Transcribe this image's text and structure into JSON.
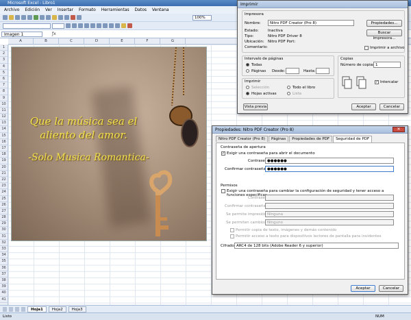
{
  "excel": {
    "title": "Microsoft Excel - Libro1",
    "menu": [
      "Archivo",
      "Edición",
      "Ver",
      "Insertar",
      "Formato",
      "Herramientas",
      "Datos",
      "Ventana"
    ],
    "name_box": "Imagen 1",
    "zoom": "100%",
    "columns": [
      "A",
      "B",
      "C",
      "D",
      "E",
      "F",
      "G"
    ],
    "picture_text_1": "Que la música sea el aliento del amor.",
    "picture_text_2": "-Solo Musica Romantica-",
    "sheets": [
      "Hoja1",
      "Hoja2",
      "Hoja3"
    ],
    "status": "Listo",
    "status_num": "NUM"
  },
  "print_dialog": {
    "title": "Imprimir",
    "printer_group": "Impresora",
    "name_label": "Nombre:",
    "name_value": "Nitro PDF Creator (Pro 8)",
    "status_label": "Estado:",
    "status_value": "Inactiva",
    "type_label": "Tipo:",
    "type_value": "Nitro PDF Driver 8",
    "location_label": "Ubicación:",
    "location_value": "Nitro PDF Port:",
    "comment_label": "Comentario:",
    "properties_btn": "Propiedades...",
    "find_printer_btn": "Buscar impresora...",
    "print_to_file": "Imprimir a archivo",
    "range_group": "Intervalo de páginas",
    "all": "Todas",
    "pages": "Páginas",
    "from": "Desde:",
    "to": "Hasta:",
    "copies_group": "Copias",
    "copies_label": "Número de copias:",
    "copies_value": "1",
    "print_group": "Imprimir",
    "selection": "Selección",
    "whole_book": "Todo el libro",
    "active_sheets": "Hojas activas",
    "list": "Lista",
    "collate": "Intercalar",
    "preview_btn": "Vista previa",
    "ok_btn": "Aceptar",
    "cancel_btn": "Cancelar"
  },
  "props_dialog": {
    "title": "Propiedades: Nitro PDF Creator (Pro 8)",
    "tabs": [
      "Nitro PDF Creator (Pro 8)",
      "Páginas",
      "Propiedades de PDF",
      "Seguridad de PDF"
    ],
    "open_group": "Contraseña de apertura",
    "require_open": "Exigir una contraseña para abrir el documento",
    "password_label": "Contraseña:",
    "password_value": "●●●●●●",
    "confirm_label": "Confirmar contraseña:",
    "confirm_value": "●●●●●●",
    "perms_group": "Permisos",
    "require_perms": "Exigir una contraseña para cambiar la configuración de seguridad y tener acceso a funciones específicas",
    "perm_password_label": "Contraseña:",
    "perm_confirm_label": "Confirmar contraseña:",
    "print_allowed_label": "Se permite impresión:",
    "print_allowed_value": "Ninguna",
    "changes_allowed_label": "Se permiten cambios:",
    "changes_allowed_value": "Ninguno",
    "copy_text": "Permitir copia de texto, imágenes y demás contenido",
    "screen_reader": "Permitir acceso a texto para dispositivos lectores de pantalla para invidentes",
    "encryption_label": "Cifrado:",
    "encryption_value": "ARC4 de 128 bits (Adobe Reader 6 y superior)",
    "ok_btn": "Aceptar",
    "cancel_btn": "Cancelar"
  }
}
